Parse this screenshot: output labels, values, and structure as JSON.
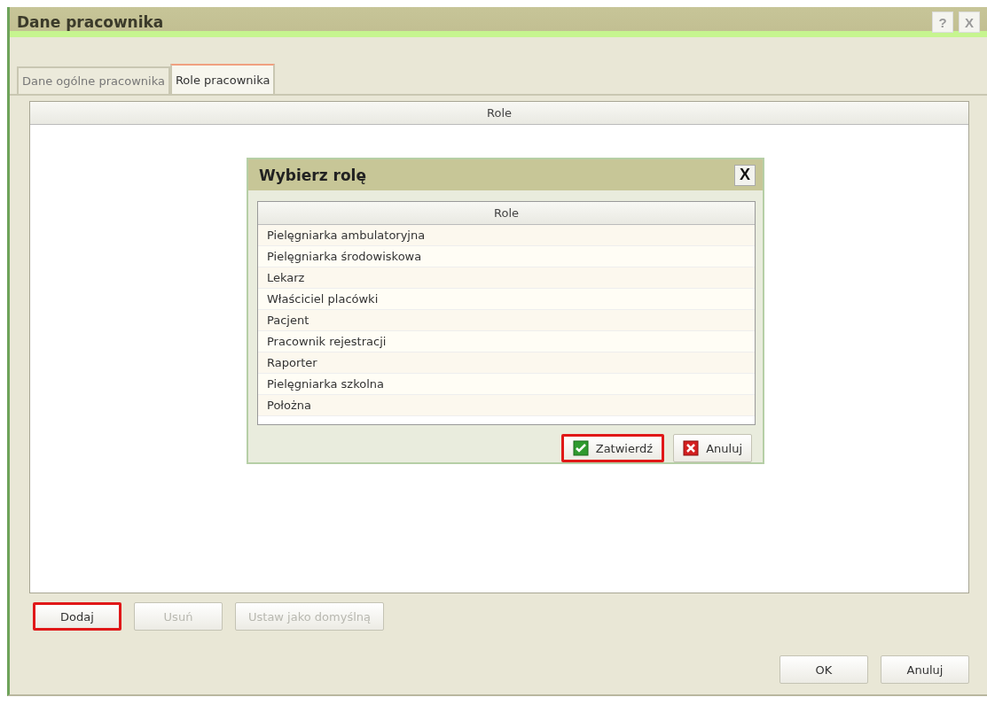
{
  "window": {
    "title": "Dane pracownika",
    "help_button": "?",
    "close_button": "X"
  },
  "tabs": [
    {
      "label": "Dane ogólne pracownika",
      "selected": false
    },
    {
      "label": "Role pracownika",
      "selected": true
    }
  ],
  "roles_table": {
    "column": "Role"
  },
  "role_buttons": [
    {
      "label": "Dodaj",
      "disabled": false,
      "highlighted": true
    },
    {
      "label": "Usuń",
      "disabled": true,
      "highlighted": false
    },
    {
      "label": "Ustaw jako domyślną",
      "disabled": true,
      "highlighted": false
    }
  ],
  "dialog": {
    "title": "Wybierz rolę",
    "close_button": "X",
    "column": "Role",
    "rows": [
      "Pielęgniarka ambulatoryjna",
      "Pielęgniarka środowiskowa",
      "Lekarz",
      "Właściciel placówki",
      "Pacjent",
      "Pracownik rejestracji",
      "Raporter",
      "Pielęgniarka szkolna",
      "Położna"
    ],
    "buttons": [
      {
        "kind": "confirm",
        "label": "Zatwierdź",
        "highlighted": true
      },
      {
        "kind": "cancel",
        "label": "Anuluj",
        "highlighted": false
      }
    ]
  },
  "footer_buttons": [
    "OK",
    "Anuluj"
  ]
}
